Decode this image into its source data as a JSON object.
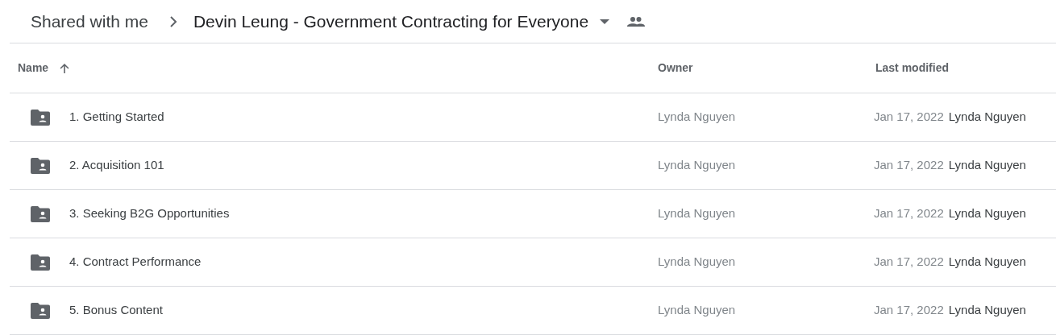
{
  "breadcrumb": {
    "parent": "Shared with me",
    "current": "Devin Leung - Government Contracting for Everyone",
    "shared": true
  },
  "table": {
    "columns": [
      {
        "label": "Name",
        "sorted": true
      },
      {
        "label": "Owner",
        "sorted": false
      },
      {
        "label": "Last modified",
        "sorted": false
      }
    ],
    "rows": [
      {
        "kind": "shared-folder",
        "name": "1. Getting Started",
        "owner": "Lynda Nguyen",
        "modified": "Jan 17, 2022",
        "modified_by": "Lynda Nguyen"
      },
      {
        "kind": "shared-folder",
        "name": "2. Acquisition 101",
        "owner": "Lynda Nguyen",
        "modified": "Jan 17, 2022",
        "modified_by": "Lynda Nguyen"
      },
      {
        "kind": "shared-folder",
        "name": "3. Seeking B2G Opportunities",
        "owner": "Lynda Nguyen",
        "modified": "Jan 17, 2022",
        "modified_by": "Lynda Nguyen"
      },
      {
        "kind": "shared-folder",
        "name": "4. Contract Performance",
        "owner": "Lynda Nguyen",
        "modified": "Jan 17, 2022",
        "modified_by": "Lynda Nguyen"
      },
      {
        "kind": "shared-folder",
        "name": "5. Bonus Content",
        "owner": "Lynda Nguyen",
        "modified": "Jan 17, 2022",
        "modified_by": "Lynda Nguyen"
      }
    ]
  }
}
